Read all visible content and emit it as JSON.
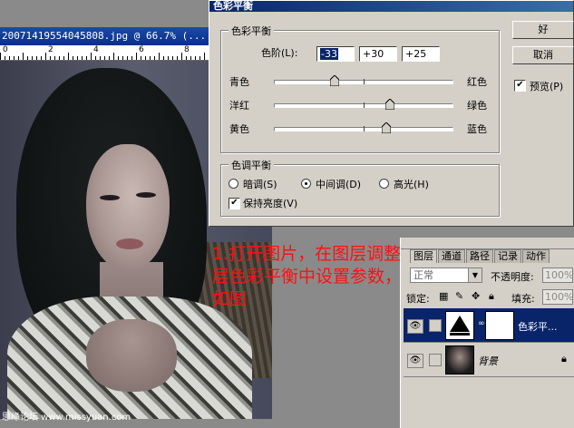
{
  "document": {
    "title": "20071419554045808.jpg @ 66.7% (...",
    "ruler_numbers": [
      "0",
      "2",
      "4",
      "6",
      "8"
    ]
  },
  "watermark": "思缘论坛 www.missyuan.com",
  "dialog": {
    "title": "色彩平衡",
    "color_balance_group": "色彩平衡",
    "levels_label": "色阶(L):",
    "levels": [
      "-33",
      "+30",
      "+25"
    ],
    "sliders": [
      {
        "left": "青色",
        "right": "红色",
        "value": -33
      },
      {
        "left": "洋红",
        "right": "绿色",
        "value": 30
      },
      {
        "left": "黄色",
        "right": "蓝色",
        "value": 25
      }
    ],
    "tone_group": "色调平衡",
    "tones": [
      {
        "label": "暗调(S)",
        "selected": false
      },
      {
        "label": "中间调(D)",
        "selected": true
      },
      {
        "label": "高光(H)",
        "selected": false
      }
    ],
    "preserve_luminosity": {
      "label": "保持亮度(V)",
      "checked": true
    },
    "ok_label": "好",
    "cancel_label": "取消",
    "preview": {
      "label": "预览(P)",
      "checked": true
    }
  },
  "annotation": "1.打开图片，在图层调整层色彩平衡中设置参数，如图",
  "layers_panel": {
    "tabs": [
      "图层",
      "通道",
      "路径",
      "记录",
      "动作"
    ],
    "blend_mode": "正常",
    "opacity_label": "不透明度:",
    "opacity_value": "100%",
    "lock_label": "锁定:",
    "fill_label": "填充:",
    "fill_value": "100%",
    "layers": [
      {
        "name": "色彩平...",
        "selected": true
      },
      {
        "name": "背景",
        "selected": false
      }
    ]
  },
  "colors": {
    "title_blue": "#0a246a",
    "annotation_red": "#ff1010",
    "dialog_bg": "#d4d0c8"
  }
}
